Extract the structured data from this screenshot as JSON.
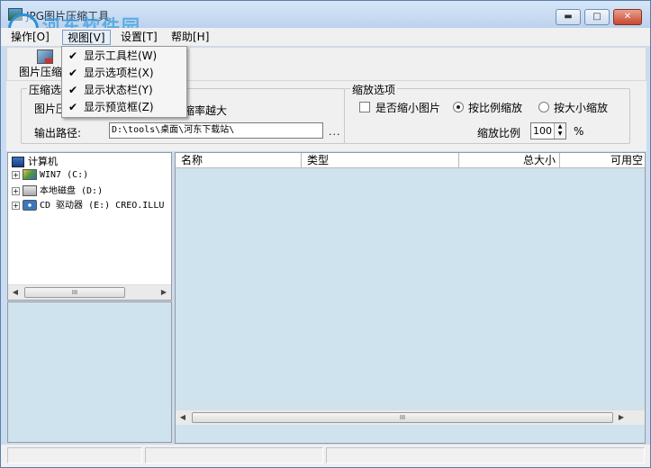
{
  "window": {
    "title": "JPG图片压缩工具",
    "watermark_text": "河东软件园",
    "watermark_url": "www.pc0359.cn"
  },
  "menu": {
    "items": [
      {
        "label": "操作[O]"
      },
      {
        "label": "视图[V]"
      },
      {
        "label": "设置[T]"
      },
      {
        "label": "帮助[H]"
      }
    ]
  },
  "view_menu": {
    "items": [
      {
        "label": "显示工具栏(W)",
        "checked": true
      },
      {
        "label": "显示选项栏(X)",
        "checked": true
      },
      {
        "label": "显示状态栏(Y)",
        "checked": true
      },
      {
        "label": "显示预览框(Z)",
        "checked": true
      }
    ]
  },
  "toolbar": {
    "compress_label": "图片压缩"
  },
  "compress_options": {
    "title": "压缩选项",
    "quality_label": "图片压",
    "quality_hint": "缩率越大",
    "output_path_label": "输出路径:",
    "output_path_value": "D:\\tools\\桌面\\河东下载站\\",
    "browse_label": "..."
  },
  "scale_options": {
    "title": "缩放选项",
    "shrink_checkbox_label": "是否缩小图片",
    "shrink_checked": false,
    "radio_proportional_label": "按比例缩放",
    "radio_proportional_selected": true,
    "radio_size_label": "按大小缩放",
    "radio_size_selected": false,
    "ratio_label": "缩放比例",
    "ratio_value": "100",
    "ratio_unit": "%"
  },
  "tree": {
    "root_label": "计算机",
    "drives": [
      {
        "name": "WIN7 (C:)",
        "icon": "windows-drive-icon"
      },
      {
        "name": "本地磁盘 (D:)",
        "icon": "local-disk-icon"
      },
      {
        "name": "CD 驱动器 (E:) CREO.ILLU",
        "icon": "cd-drive-icon"
      }
    ]
  },
  "file_list": {
    "columns": [
      "名称",
      "类型",
      "总大小",
      "可用空"
    ]
  },
  "scrollbar": {
    "thumb_grip": "III"
  }
}
